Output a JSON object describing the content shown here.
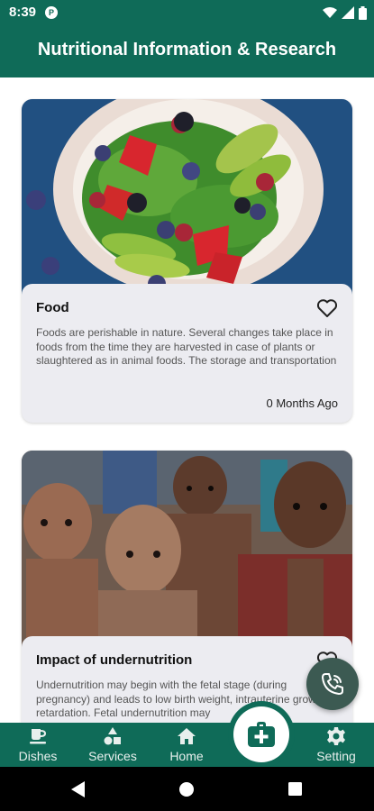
{
  "status_bar": {
    "time": "8:39",
    "notification_icon": "app-notification-icon",
    "icons": [
      "wifi-icon",
      "signal-icon",
      "battery-icon"
    ]
  },
  "header": {
    "title": "Nutritional Information & Research"
  },
  "cards": [
    {
      "title": "Food",
      "description": "Foods are perishable in nature. Several changes take place in foods from the time they are harvested in case of plants or slaughtered as in animal foods. The storage and transportation",
      "date": "0 Months Ago",
      "image": "salad-photo",
      "icon": "heart-outline-icon"
    },
    {
      "title": "Impact of undernutrition",
      "description": "Undernutrition may begin with the fetal stage (during pregnancy) and leads to low birth weight, intrauterine growth retardation. Fetal undernutrition may",
      "image": "malnourished-children-photo",
      "icon": "heart-outline-icon"
    }
  ],
  "bottom_nav": {
    "items": [
      {
        "label": "Dishes",
        "icon": "dishes-icon"
      },
      {
        "label": "Services",
        "icon": "services-icon"
      },
      {
        "label": "Home",
        "icon": "home-icon"
      },
      {
        "label": "Setting",
        "icon": "gear-icon"
      }
    ],
    "center_icon": "medical-kit-icon"
  },
  "floating_button": {
    "icon": "phone-call-icon"
  },
  "colors": {
    "primary": "#0f6b58",
    "card_bg": "#ececf1",
    "fab_dark": "#3c5a52"
  }
}
